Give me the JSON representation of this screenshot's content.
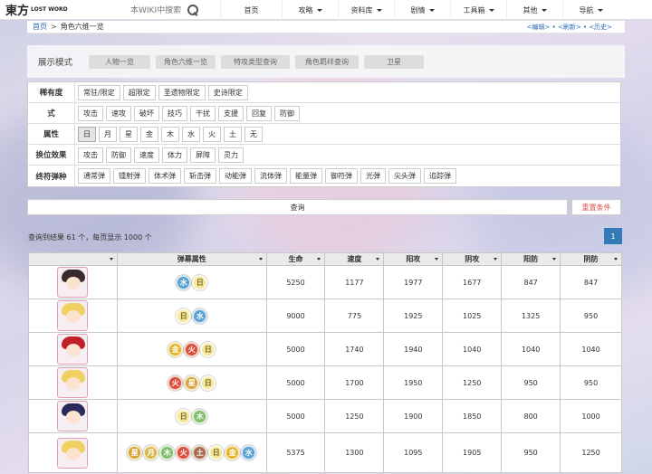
{
  "nav": {
    "logo_mark": "東方",
    "logo_text": "LOST WORD",
    "search_placeholder": "本WIKI中搜索",
    "items": [
      {
        "label": "首页",
        "dropdown": false
      },
      {
        "label": "攻略",
        "dropdown": true
      },
      {
        "label": "资料库",
        "dropdown": true
      },
      {
        "label": "剧情",
        "dropdown": true
      },
      {
        "label": "工具箱",
        "dropdown": true
      },
      {
        "label": "其他",
        "dropdown": true
      },
      {
        "label": "导航",
        "dropdown": true
      }
    ]
  },
  "breadcrumb": {
    "home": "首页",
    "sep": ">",
    "current": "角色六维一览",
    "tools": "<编辑> • <刷新> • <历史>"
  },
  "mode": {
    "title": "展示模式",
    "tabs": [
      "人物一览",
      "角色六维一览",
      "特攻类型查询",
      "角色羁绊查询",
      "卫星"
    ]
  },
  "filters": [
    {
      "label": "稀有度",
      "options": [
        "常驻/限定",
        "超限定",
        "圣遗物限定",
        "史诗限定"
      ],
      "selected": []
    },
    {
      "label": "式",
      "options": [
        "攻击",
        "速攻",
        "破坏",
        "技巧",
        "干扰",
        "支援",
        "回复",
        "防御"
      ],
      "selected": []
    },
    {
      "label": "属性",
      "options": [
        "日",
        "月",
        "星",
        "金",
        "木",
        "水",
        "火",
        "土",
        "无"
      ],
      "selected": [
        0
      ]
    },
    {
      "label": "换位效果",
      "options": [
        "攻击",
        "防御",
        "速度",
        "体力",
        "屏障",
        "灵力"
      ],
      "selected": []
    },
    {
      "label": "终符弹种",
      "options": [
        "通常弹",
        "镭射弹",
        "体术弹",
        "斩击弹",
        "动能弹",
        "流体弹",
        "能量弹",
        "御符弹",
        "光弹",
        "尖头弹",
        "追踪弹"
      ],
      "selected": []
    }
  ],
  "actions": {
    "query": "查询",
    "reset": "重置条件"
  },
  "result": {
    "text": "查询到结果 61 个，每页显示 1000 个",
    "page": "1"
  },
  "table": {
    "headers": [
      "",
      "弹幕属性",
      "生命",
      "速度",
      "阳攻",
      "阴攻",
      "阳防",
      "阴防"
    ],
    "rows": [
      {
        "attrs": [
          "水",
          "日"
        ],
        "life": "5250",
        "speed": "1177",
        "yang_atk": "1977",
        "yin_atk": "1677",
        "yang_def": "847",
        "yin_def": "847",
        "hair": "#3a2a2a"
      },
      {
        "attrs": [
          "日",
          "水"
        ],
        "life": "9000",
        "speed": "775",
        "yang_atk": "1925",
        "yin_atk": "1025",
        "yang_def": "1325",
        "yin_def": "950",
        "hair": "#f0d060"
      },
      {
        "attrs": [
          "金",
          "火",
          "日"
        ],
        "life": "5000",
        "speed": "1740",
        "yang_atk": "1940",
        "yin_atk": "1040",
        "yang_def": "1040",
        "yin_def": "1040",
        "hair": "#c0202a"
      },
      {
        "attrs": [
          "火",
          "星",
          "日"
        ],
        "life": "5000",
        "speed": "1700",
        "yang_atk": "1950",
        "yin_atk": "1250",
        "yang_def": "950",
        "yin_def": "950",
        "hair": "#f0d060"
      },
      {
        "attrs": [
          "日",
          "木"
        ],
        "life": "5000",
        "speed": "1250",
        "yang_atk": "1900",
        "yin_atk": "1850",
        "yang_def": "800",
        "yin_def": "1000",
        "hair": "#2a2a5a"
      },
      {
        "attrs": [
          "星",
          "月",
          "木",
          "火",
          "土",
          "日",
          "金",
          "水"
        ],
        "life": "5375",
        "speed": "1300",
        "yang_atk": "1095",
        "yin_atk": "1905",
        "yang_def": "950",
        "yin_def": "1250",
        "hair": "#f0d060"
      }
    ]
  },
  "colors": {
    "日": "#f5e79a",
    "月": "#d8b84a",
    "星": "#d9a53a",
    "金": "#e2b52a",
    "木": "#7fbf6a",
    "水": "#5aa0d0",
    "火": "#d9503a",
    "土": "#a86a4a",
    "无": "#bbbbbb",
    "link": "#2a6ab8",
    "accent": "#337ab7",
    "reset": "#d9534f"
  }
}
